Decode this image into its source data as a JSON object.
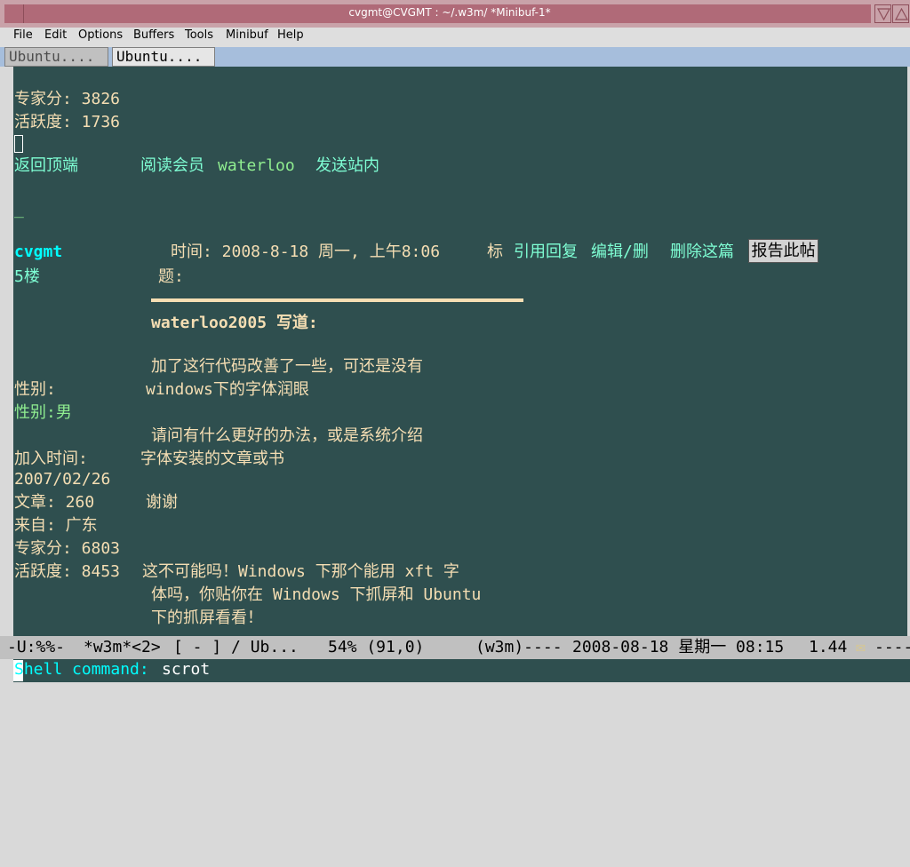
{
  "window": {
    "title": "cvgmt@CVGMT : ~/.w3m/ *Minibuf-1*"
  },
  "menubar": {
    "items": [
      "File",
      "Edit",
      "Options",
      "Buffers",
      "Tools",
      "Minibuf",
      "Help"
    ]
  },
  "tabs": [
    {
      "label": "Ubuntu....",
      "active": false
    },
    {
      "label": "Ubuntu....",
      "active": true
    }
  ],
  "page": {
    "expert_score_1": "专家分: 3826",
    "activity_1": "活跃度: 1736",
    "nav_links": [
      "返回顶端",
      "阅读会员",
      "waterloo",
      "发送站内"
    ],
    "underscore": "_",
    "post": {
      "author": "cvgmt",
      "floor": "5楼",
      "time_label": "时间: 2008-8-18 周一, 上午8:06",
      "subject_label_a": "标",
      "subject_label_b": "题:",
      "actions": [
        "引用回复",
        "编辑/删",
        "删除这篇"
      ],
      "report_button": "报告此帖",
      "quote_header": "waterloo2005 写道:",
      "quote_lines": [
        "加了这行代码改善了一些，可还是没有",
        "windows下的字体润眼",
        "请问有什么更好的办法，或是系统介绍",
        "字体安装的文章或书",
        "谢谢"
      ],
      "reply_lines": [
        "这不可能吗！Windows 下那个能用 xft 字",
        "体吗，你贴你在 Windows 下抓屏和 Ubuntu",
        "下的抓屏看看！"
      ]
    },
    "profile": {
      "gender_label": "性别:",
      "gender_value": "性别:男",
      "join_label": "加入时间:",
      "join_date": "2007/02/26",
      "posts": "文章: 260",
      "from": "来自: 广东",
      "expert_score": "专家分: 6803",
      "activity": "活跃度: 8453"
    }
  },
  "modeline": {
    "status": "-U:%%-",
    "buffer": "*w3m*<2>",
    "flags": "[ - ] / Ub...",
    "position": "54% (91,0)",
    "mode": "(w3m)----",
    "datetime": "2008-08-18 星期一 08:15",
    "load": "1.44",
    "mail_icon": "envelope-icon",
    "tail": "----"
  },
  "minibuffer": {
    "prompt": "Shell command: ",
    "input": "scrot"
  },
  "colors": {
    "buffer_bg": "#2f4f4f",
    "text": "#f5deb3",
    "link": "#7fffd4",
    "cyan": "#00ffff",
    "titlebar": "#b06a78",
    "tabbar": "#a6bedc"
  }
}
